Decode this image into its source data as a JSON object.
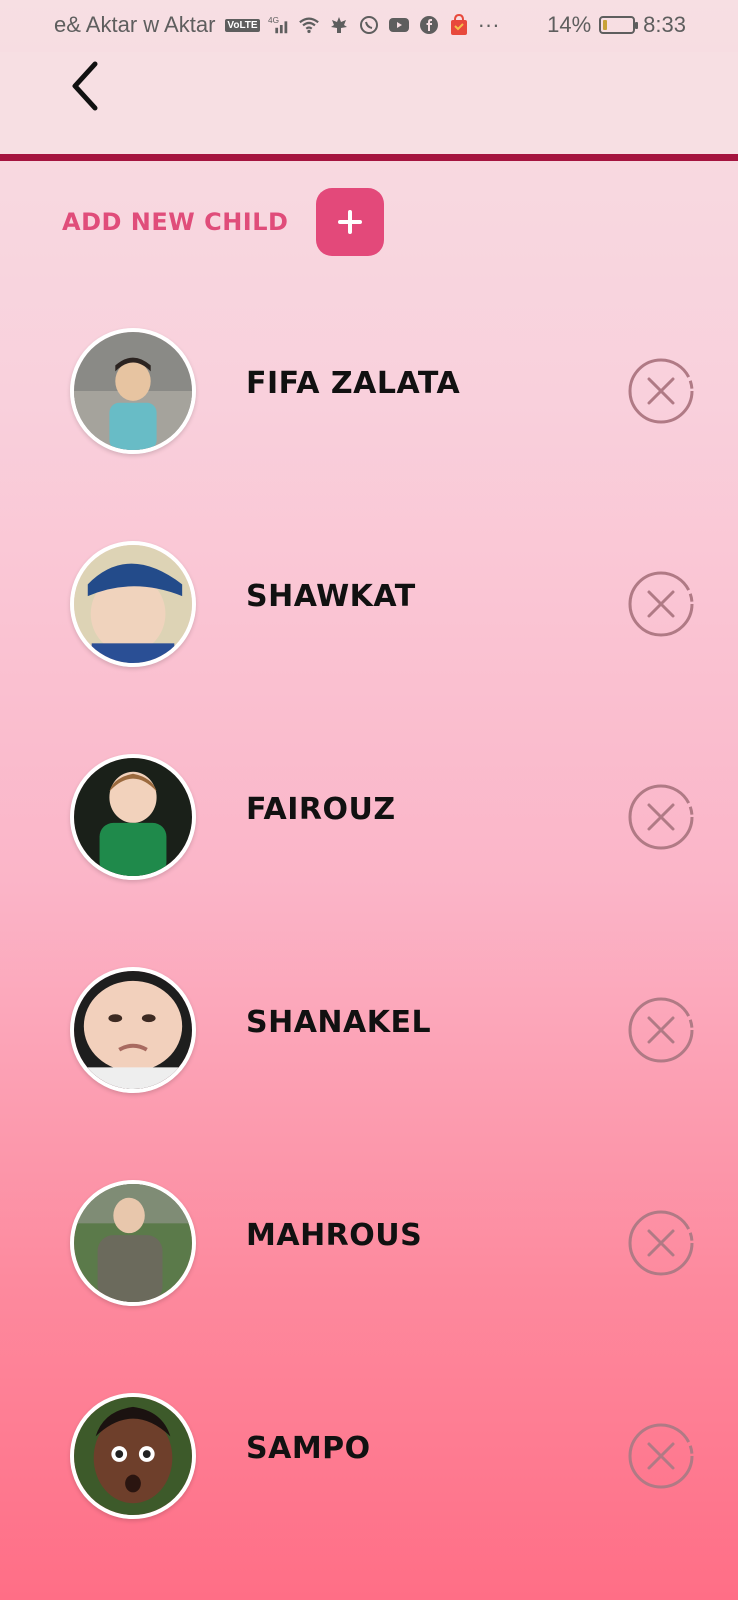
{
  "status_bar": {
    "carrier": "e& Aktar w Aktar",
    "volte": "VoLTE",
    "network": "4G",
    "more": "···",
    "battery_percent": "14%",
    "battery_level": 0.14,
    "time": "8:33"
  },
  "header": {
    "back_icon": "chevron-left-icon"
  },
  "add_child": {
    "label": "ADD NEW CHILD",
    "button_icon": "plus-icon"
  },
  "children": [
    {
      "name": "FIFA ZALATA",
      "remove_icon": "close-circle-icon"
    },
    {
      "name": "SHAWKAT",
      "remove_icon": "close-circle-icon"
    },
    {
      "name": "FAIROUZ",
      "remove_icon": "close-circle-icon"
    },
    {
      "name": "SHANAKEL",
      "remove_icon": "close-circle-icon"
    },
    {
      "name": "MAHROUS",
      "remove_icon": "close-circle-icon"
    },
    {
      "name": "SAMPO",
      "remove_icon": "close-circle-icon"
    }
  ],
  "colors": {
    "accent": "#e3497a",
    "header_line": "#a5143f",
    "remove_icon": "#b07a85"
  }
}
